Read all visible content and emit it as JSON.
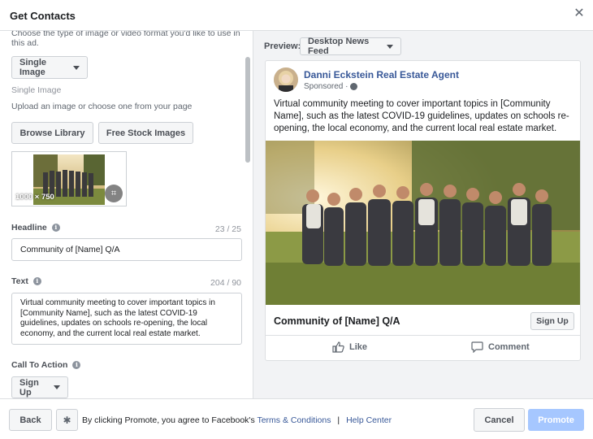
{
  "header": {
    "title": "Get Contacts",
    "close_icon": "close-icon"
  },
  "left": {
    "intro": "Choose the type of image or video format you'd like to use in this ad.",
    "format_select": "Single Image",
    "section_title": "Single Image",
    "upload_hint": "Upload an image or choose one from your page",
    "browse_label": "Browse Library",
    "stock_label": "Free Stock Images",
    "thumb_size": "1000 × 750",
    "headline": {
      "label": "Headline",
      "counter": "23 / 25",
      "value": "Community of [Name] Q/A"
    },
    "text": {
      "label": "Text",
      "counter": "204 / 90",
      "value": "Virtual community meeting to cover important topics in [Community Name], such as the latest COVID-19 guidelines, updates on schools re-opening, the local economy, and the current local real estate market."
    },
    "cta": {
      "label": "Call To Action",
      "value": "Sign Up"
    }
  },
  "preview": {
    "label": "Preview:",
    "placement": "Desktop News Feed",
    "page_name": "Danni Eckstein Real Estate Agent",
    "sponsored": "Sponsored ·",
    "post_text": "Virtual community meeting to cover important topics in [Community Name], such as the latest COVID-19 guidelines, updates on schools re-opening, the local economy, and the current local real estate market.",
    "headline": "Community of [Name] Q/A",
    "cta": "Sign Up",
    "like": "Like",
    "comment": "Comment"
  },
  "footer": {
    "back": "Back",
    "consent": "By clicking Promote, you agree to Facebook's",
    "terms": "Terms & Conditions",
    "separator": "|",
    "help": "Help Center",
    "cancel": "Cancel",
    "promote": "Promote"
  },
  "colors": {
    "link": "#385898",
    "promote_disabled": "#a6c7ff",
    "border": "#dddfe2"
  }
}
